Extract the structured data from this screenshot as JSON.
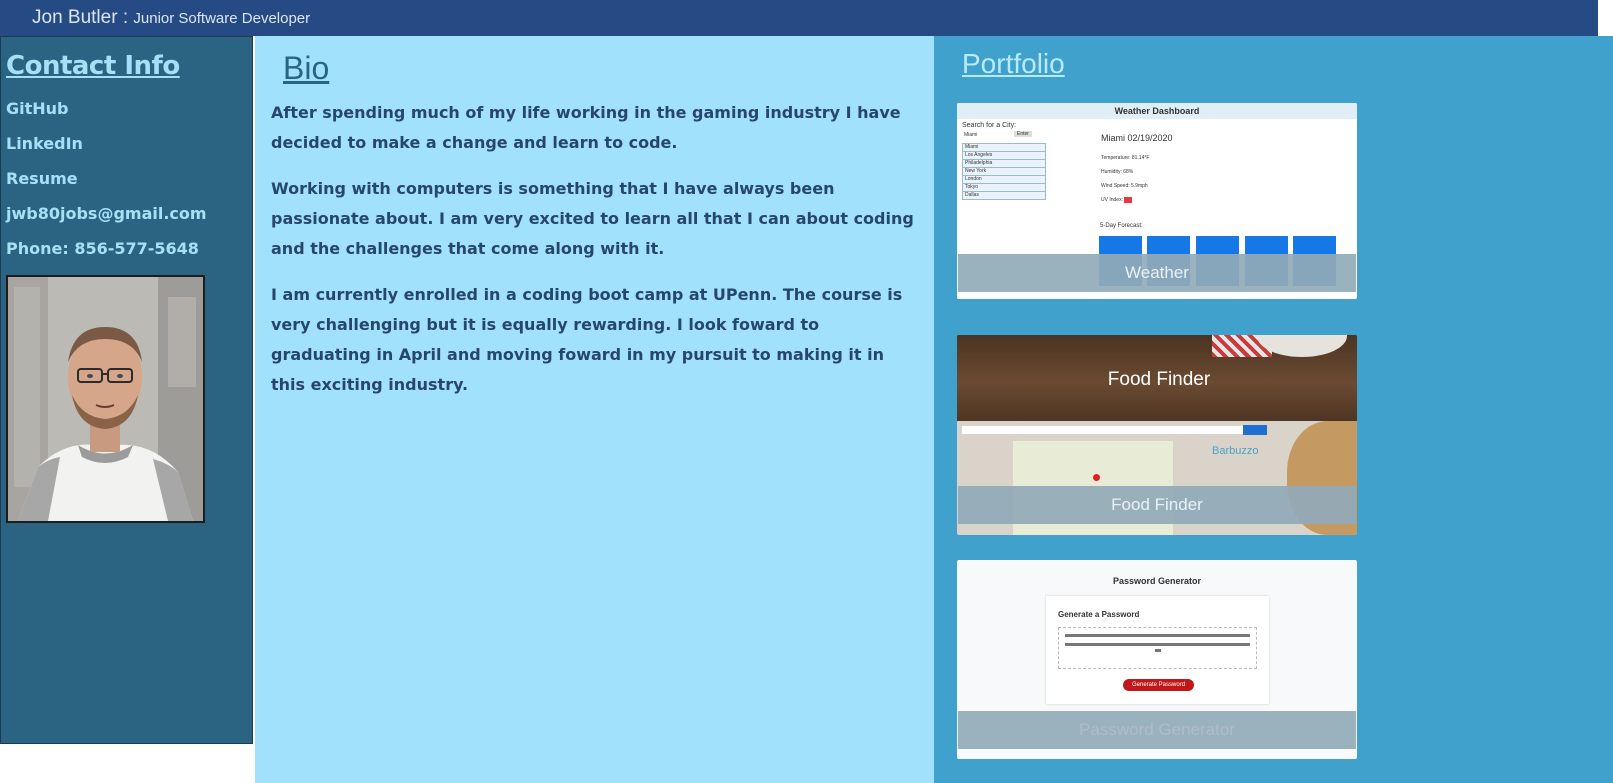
{
  "header": {
    "name": "Jon Butler",
    "separator": " : ",
    "role": "Junior Software Developer"
  },
  "contact": {
    "title": "Contact Info",
    "links": [
      "GitHub",
      "LinkedIn",
      "Resume",
      "jwb80jobs@gmail.com",
      "Phone: 856-577-5648"
    ]
  },
  "bio": {
    "title": "Bio",
    "paragraphs": [
      "After spending much of my life working in the gaming industry I have decided to make a change and learn to code.",
      "Working with computers is something that I have always been passionate about. I am very excited to learn all that I can about coding and the challenges that come along with it.",
      "I am currently enrolled in a coding boot camp at UPenn. The course is very challenging but it is equally rewarding. I look foward to graduating in April and moving foward in my pursuit to making it in this exciting industry."
    ]
  },
  "portfolio": {
    "title": "Portfolio",
    "projects": [
      {
        "label": "Weather",
        "screenshot": {
          "heading": "Weather Dashboard",
          "search_label": "Search for a City:",
          "search_value": "Miami",
          "search_button": "Enter",
          "cities": [
            "Miami",
            "Los Angeles",
            "Philadelphia",
            "New York",
            "London",
            "Tokyo",
            "Dallas"
          ],
          "current": "Miami 02/19/2020",
          "details": [
            "Temperature: 81.14°F",
            "Humidity: 68%",
            "Wind Speed: 5.9mph",
            "UV Index:"
          ],
          "forecast_title": "5-Day Forecast:"
        }
      },
      {
        "label": "Food Finder",
        "screenshot": {
          "banner": "Food Finder",
          "restaurant": "Barbuzzo"
        }
      },
      {
        "label": "Password Generator",
        "screenshot": {
          "heading": "Password Generator",
          "card_title": "Generate a Password",
          "button": "Generate Password"
        }
      }
    ]
  }
}
